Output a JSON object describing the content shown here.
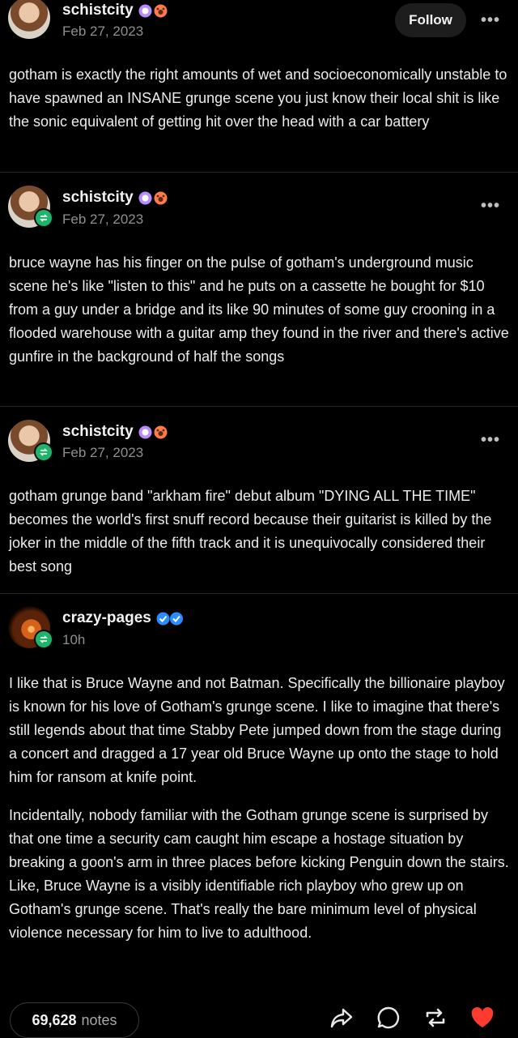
{
  "follow_label": "Follow",
  "more_label": "•••",
  "posts": [
    {
      "username": "schistcity",
      "date": "Feb 27, 2023",
      "text": "gotham is exactly the right amounts of wet and socioeconomically unstable to have spawned an INSANE grunge scene you just know their local shit is like the sonic equivalent of getting hit over the head with a car battery"
    },
    {
      "username": "schistcity",
      "date": "Feb 27, 2023",
      "text": "bruce wayne has his finger on the pulse of gotham's underground music scene he's like \"listen to this\" and he puts on a cassette he bought for $10 from a guy under a bridge and its like 90 minutes of some guy crooning in a flooded warehouse with a guitar amp they found in the river and there's active gunfire in the background of half the songs"
    },
    {
      "username": "schistcity",
      "date": "Feb 27, 2023",
      "text": "gotham grunge band \"arkham fire\" debut album \"DYING ALL THE TIME\" becomes the world's first snuff record because their guitarist is killed by the joker in the middle of the fifth track and it is unequivocally considered their best song"
    },
    {
      "username": "crazy-pages",
      "date": "10h",
      "paragraphs": [
        "I like that is Bruce Wayne and not Batman. Specifically the billionaire playboy is known for his love of Gotham's grunge scene. I like to imagine that there's still legends about that time Stabby Pete jumped down from the stage during a concert and dragged a 17 year old Bruce Wayne up onto the stage to hold him for ransom at knife point.",
        "Incidentally, nobody familiar with the Gotham grunge scene is surprised by that one time a security cam caught him escape a hostage situation by breaking a goon's arm in three places before kicking Penguin down the stairs. Like, Bruce Wayne is a visibly identifiable rich playboy who grew up on Gotham's grunge scene. That's really the bare minimum level of physical violence necessary for him to live to adulthood."
      ]
    }
  ],
  "footer": {
    "notes_count": "69,628",
    "notes_label": "notes"
  },
  "icons": {
    "badge": "purple-circle-badge",
    "badge2": "paw-badge",
    "verified": "blue-verified-badge",
    "reblog": "reblog-icon",
    "share": "share-icon",
    "reply": "reply-icon",
    "like": "heart-icon"
  },
  "colors": {
    "background": "#000000",
    "reblog_green": "#21b36b",
    "heart_red": "#ff3b30",
    "verified_blue": "#2b8cff"
  }
}
